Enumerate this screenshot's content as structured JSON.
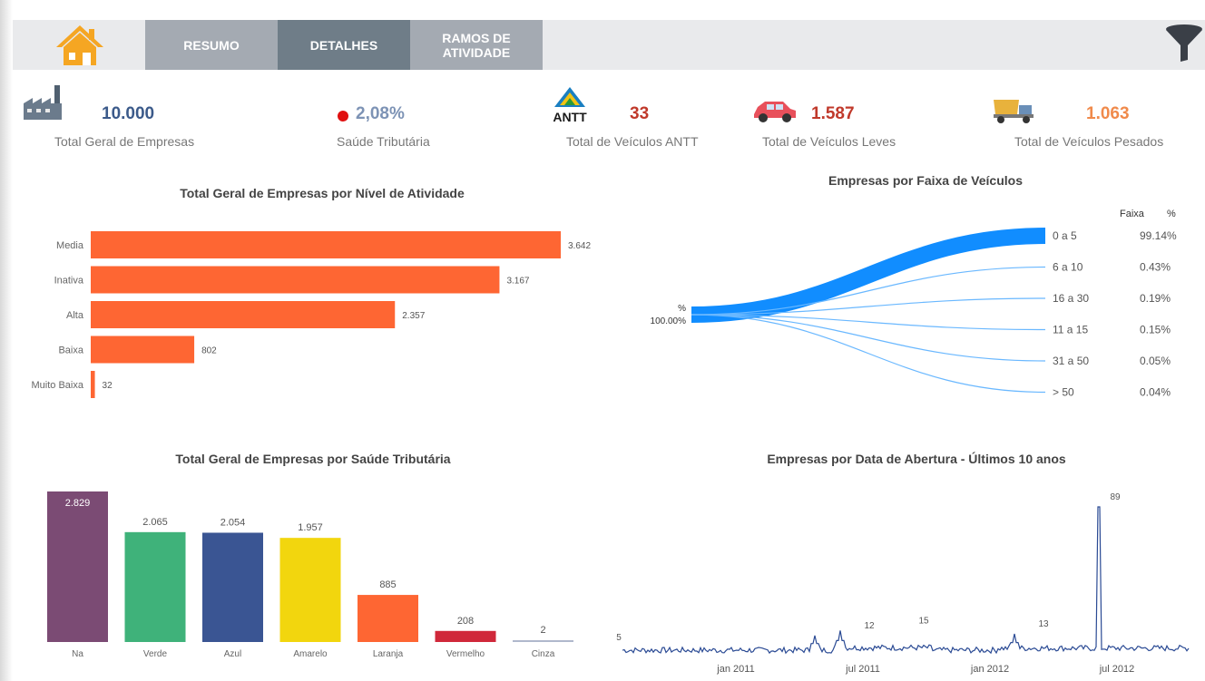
{
  "nav": {
    "tabs": [
      {
        "label": "RESUMO"
      },
      {
        "label": "DETALHES"
      },
      {
        "label": "RAMOS DE\nATIVIDADE"
      }
    ]
  },
  "kpis": {
    "total_empresas": {
      "value": "10.000",
      "label": "Total Geral de Empresas"
    },
    "saude_tributaria": {
      "value": "2,08%",
      "label": "Saúde Tributária"
    },
    "veiculos_antt": {
      "value": "33",
      "label": "Total de Veículos ANTT",
      "logo_text": "ANTT"
    },
    "veiculos_leves": {
      "value": "1.587",
      "label": "Total de Veículos Leves"
    },
    "veiculos_pesados": {
      "value": "1.063",
      "label": "Total de Veículos Pesados"
    }
  },
  "colors": {
    "accent_orange": "#fe6633",
    "kpi_value_blue": "#3b5a8a",
    "kpi_value_red": "#c0392b",
    "kpi_value_orange": "#f08a4b",
    "status_red": "#e01010",
    "decomp_blue": "#118dff",
    "line_navy": "#2a4a94"
  },
  "chart_data": [
    {
      "type": "bar",
      "orientation": "horizontal",
      "title": "Total Geral de Empresas por Nível de Atividade",
      "categories": [
        "Media",
        "Inativa",
        "Alta",
        "Baixa",
        "Muito Baixa"
      ],
      "values": [
        3642,
        3167,
        2357,
        802,
        32
      ],
      "data_labels": [
        "3.642",
        "3.167",
        "2.357",
        "802",
        "32"
      ],
      "color": "#fe6633"
    },
    {
      "type": "decomposition",
      "title": "Empresas por Faixa de Veículos",
      "root_label": "%",
      "root_value": "100.00%",
      "header": {
        "faixa": "Faixa",
        "pct": "%"
      },
      "categories": [
        "0 a 5",
        "6 a 10",
        "16 a 30",
        "11 a 15",
        "31 a 50",
        "> 50"
      ],
      "values": [
        99.14,
        0.43,
        0.19,
        0.15,
        0.05,
        0.04
      ],
      "value_labels": [
        "99.14%",
        "0.43%",
        "0.19%",
        "0.15%",
        "0.05%",
        "0.04%"
      ]
    },
    {
      "type": "bar",
      "title": "Total Geral de Empresas por Saúde Tributária",
      "categories": [
        "Na",
        "Verde",
        "Azul",
        "Amarelo",
        "Laranja",
        "Vermelho",
        "Cinza"
      ],
      "values": [
        2829,
        2065,
        2054,
        1957,
        885,
        208,
        2
      ],
      "data_labels": [
        "2.829",
        "2.065",
        "2.054",
        "1.957",
        "885",
        "208",
        "2"
      ],
      "colors": [
        "#7b4b74",
        "#3fb27a",
        "#3a5593",
        "#f2d60e",
        "#fe6633",
        "#d0283a",
        "#b0b8cc"
      ]
    },
    {
      "type": "line",
      "title": "Empresas por Data de Abertura - Últimos 10 anos",
      "x_ticks": [
        "jan 2011",
        "jul 2011",
        "jan 2012",
        "jul 2012"
      ],
      "annotations": [
        {
          "x": "2010-08",
          "y": 5,
          "label": "5"
        },
        {
          "x": "2011-06",
          "y": 12,
          "label": "12"
        },
        {
          "x": "2011-08",
          "y": 15,
          "label": "15"
        },
        {
          "x": "2012-04",
          "y": 13,
          "label": "13"
        },
        {
          "x": "2012-06",
          "y": 89,
          "label": "89"
        }
      ],
      "ylim": [
        0,
        89
      ],
      "color": "#2a4a94"
    }
  ]
}
